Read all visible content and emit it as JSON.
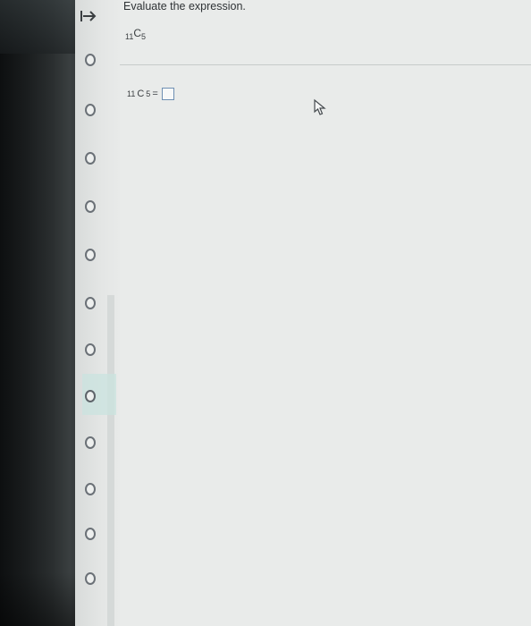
{
  "nav": {
    "top_icon": "arrow-right-bar-icon",
    "items_count_note": "",
    "highlight_index": 7
  },
  "question": {
    "instruction": "Evaluate the expression.",
    "expr_prefix": "11",
    "expr_letter": "C",
    "expr_suffix": "5",
    "answer_prefix": "11",
    "answer_letter": "C",
    "answer_suffix": "5",
    "equals": "=",
    "answer_value": ""
  },
  "colors": {
    "accent_highlight": "#c9e3df",
    "input_border": "#6e8fb3"
  }
}
